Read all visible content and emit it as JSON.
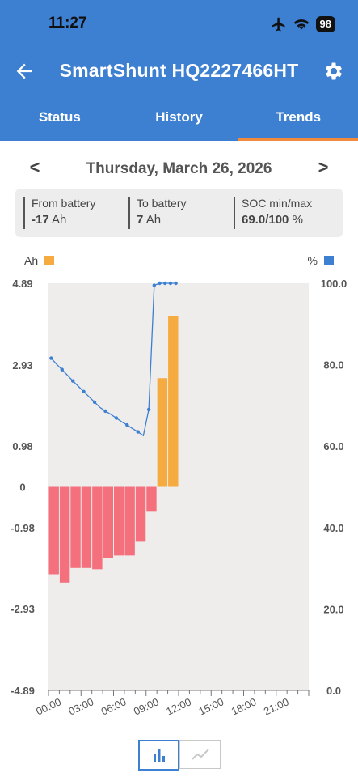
{
  "status_bar": {
    "time": "11:27",
    "battery": "98"
  },
  "app": {
    "title": "SmartShunt HQ2227466HT"
  },
  "tabs": [
    {
      "label": "Status",
      "active": false
    },
    {
      "label": "History",
      "active": false
    },
    {
      "label": "Trends",
      "active": true
    }
  ],
  "date_nav": {
    "prev": "<",
    "date": "Thursday, March 26, 2026",
    "next": ">"
  },
  "summary": [
    {
      "label": "From battery",
      "value": "-17",
      "unit": "Ah"
    },
    {
      "label": "To battery",
      "value": "7",
      "unit": "Ah"
    },
    {
      "label": "SOC min/max",
      "value": "69.0/100",
      "unit": "%"
    }
  ],
  "legend": {
    "left_label": "Ah",
    "left_color": "#f5ab3f",
    "right_label": "%",
    "right_color": "#3d7fd1"
  },
  "colors": {
    "accent": "#3d7fd1",
    "tab_indicator": "#f28a3c",
    "negative_bar": "#f4707c",
    "positive_bar": "#f5ab3f",
    "plot_bg": "#eeedec"
  },
  "chart_data": {
    "type": "bar",
    "x_tick_labels": [
      "00:00",
      "03:00",
      "06:00",
      "09:00",
      "12:00",
      "15:00",
      "18:00",
      "21:00"
    ],
    "y_left_ticks": [
      "4.89",
      "2.93",
      "0.98",
      "0",
      "-0.98",
      "-2.93",
      "-4.89"
    ],
    "y_left_values": [
      4.89,
      2.93,
      0.98,
      0,
      -0.98,
      -2.93,
      -4.89
    ],
    "y_right_ticks": [
      "100.0",
      "80.0",
      "60.0",
      "40.0",
      "20.0",
      "0.0"
    ],
    "y_left_range": [
      -4.89,
      4.89
    ],
    "y_right_range": [
      0,
      100
    ],
    "x_range_hours": [
      0,
      24
    ],
    "series": [
      {
        "kind": "bar",
        "axis": "left",
        "hours": [
          0,
          1,
          2,
          3,
          4,
          5,
          6,
          7,
          8,
          9,
          10,
          11
        ],
        "values": [
          -2.1,
          -2.3,
          -1.95,
          -1.95,
          -1.98,
          -1.72,
          -1.65,
          -1.65,
          -1.32,
          -0.58,
          2.61,
          4.1
        ]
      },
      {
        "kind": "line",
        "axis": "right",
        "hours": [
          0.25,
          0.75,
          1.25,
          1.75,
          2.25,
          2.75,
          3.25,
          3.75,
          4.25,
          4.75,
          5.25,
          5.75,
          6.25,
          6.75,
          7.25,
          7.75,
          8.25,
          8.75,
          9.25,
          9.75,
          10.25,
          10.75,
          11.25,
          11.75
        ],
        "values": [
          81.6,
          80.1,
          78.8,
          77.4,
          76.0,
          74.7,
          73.4,
          72.1,
          70.8,
          69.5,
          68.6,
          67.8,
          66.9,
          66.0,
          65.2,
          64.3,
          63.5,
          62.6,
          69.0,
          99.5,
          100.0,
          100.0,
          100.0,
          100.0
        ]
      }
    ]
  }
}
